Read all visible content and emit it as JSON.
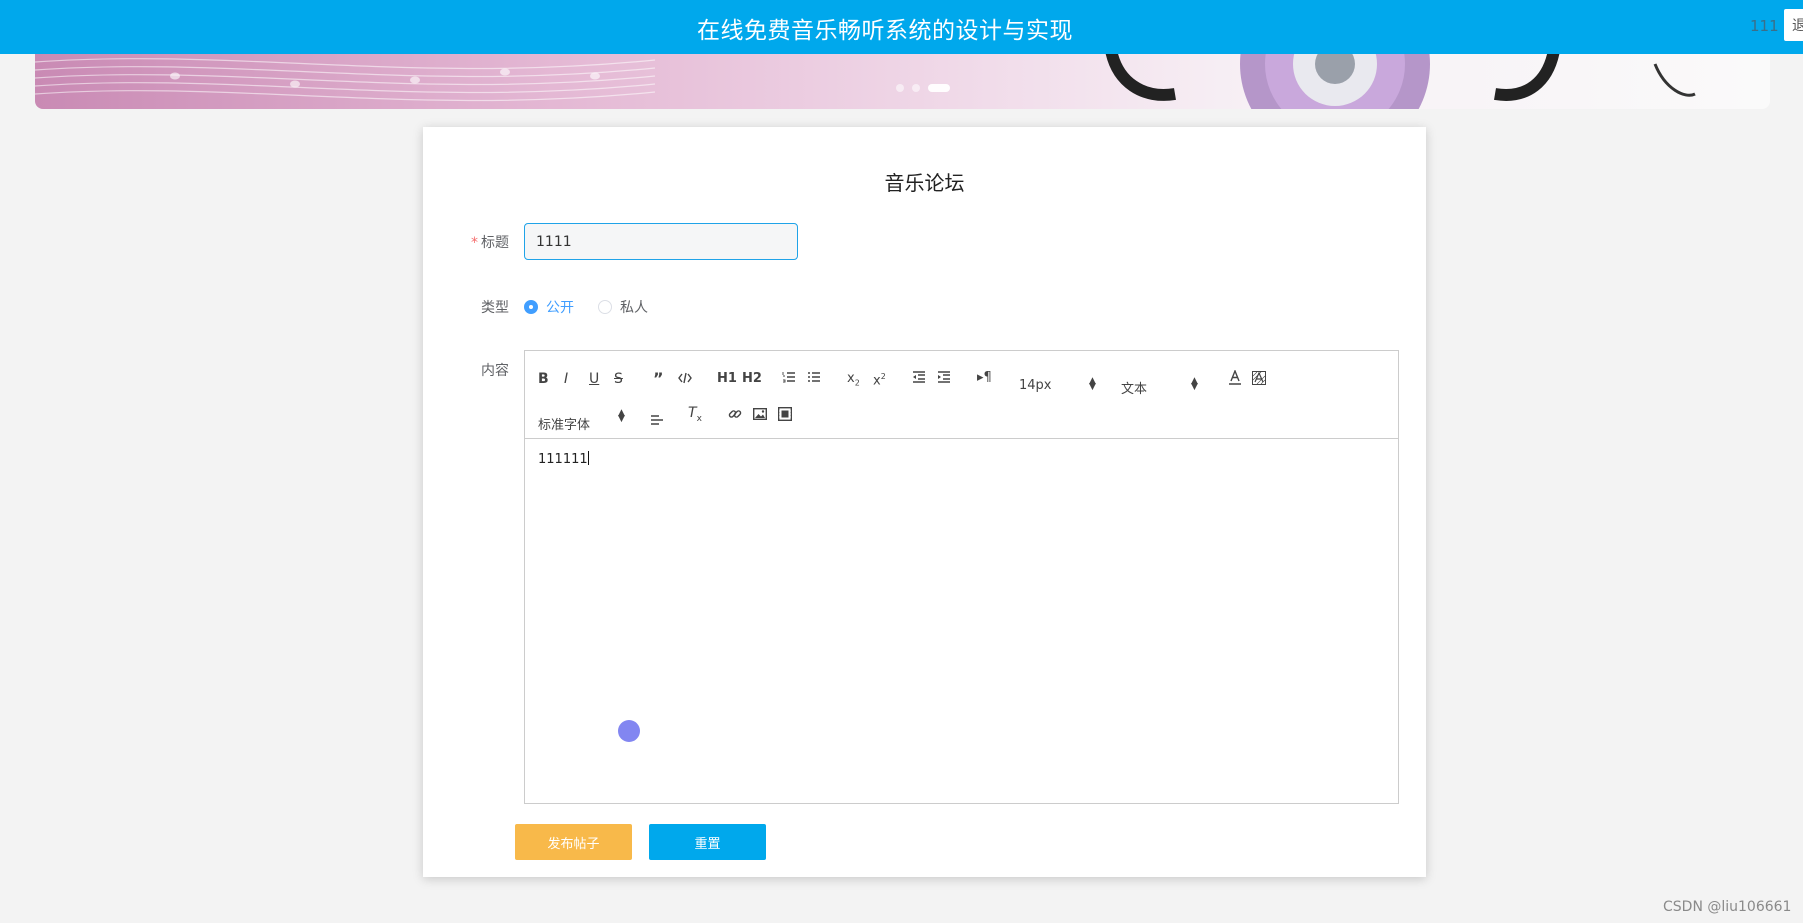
{
  "header": {
    "site_title": "在线免费音乐畅听系统的设计与实现",
    "user_name": "111",
    "logout_label": "退"
  },
  "banner": {
    "slide_count": 3,
    "active_slide": 3
  },
  "form": {
    "title": "音乐论坛",
    "title_label": "标题",
    "title_required_mark": "*",
    "title_value": "1111",
    "type_label": "类型",
    "type_options": [
      "公开",
      "私人"
    ],
    "type_selected": "公开",
    "content_label": "内容",
    "content_value": "111111",
    "publish_label": "发布帖子",
    "reset_label": "重置"
  },
  "editor_toolbar": {
    "bold": "B",
    "italic": "I",
    "underline": "U",
    "strike": "S",
    "h1": "H1",
    "h2": "H2",
    "font_size": "14px",
    "header_picker": "文本",
    "font_family": "标准字体",
    "icons": [
      "bold-icon",
      "italic-icon",
      "underline-icon",
      "strike-icon",
      "blockquote-icon",
      "code-block-icon",
      "header-1-icon",
      "header-2-icon",
      "ordered-list-icon",
      "bullet-list-icon",
      "subscript-icon",
      "superscript-icon",
      "outdent-icon",
      "indent-icon",
      "direction-icon",
      "font-color-icon",
      "background-color-icon",
      "align-icon",
      "clean-format-icon",
      "link-icon",
      "image-icon",
      "video-icon"
    ]
  },
  "watermark": "CSDN @liu106661",
  "colors": {
    "header_bg": "#00a8ec",
    "publish_btn": "#f8b94a",
    "reset_btn": "#00a8ec",
    "accent": "#409eff"
  }
}
